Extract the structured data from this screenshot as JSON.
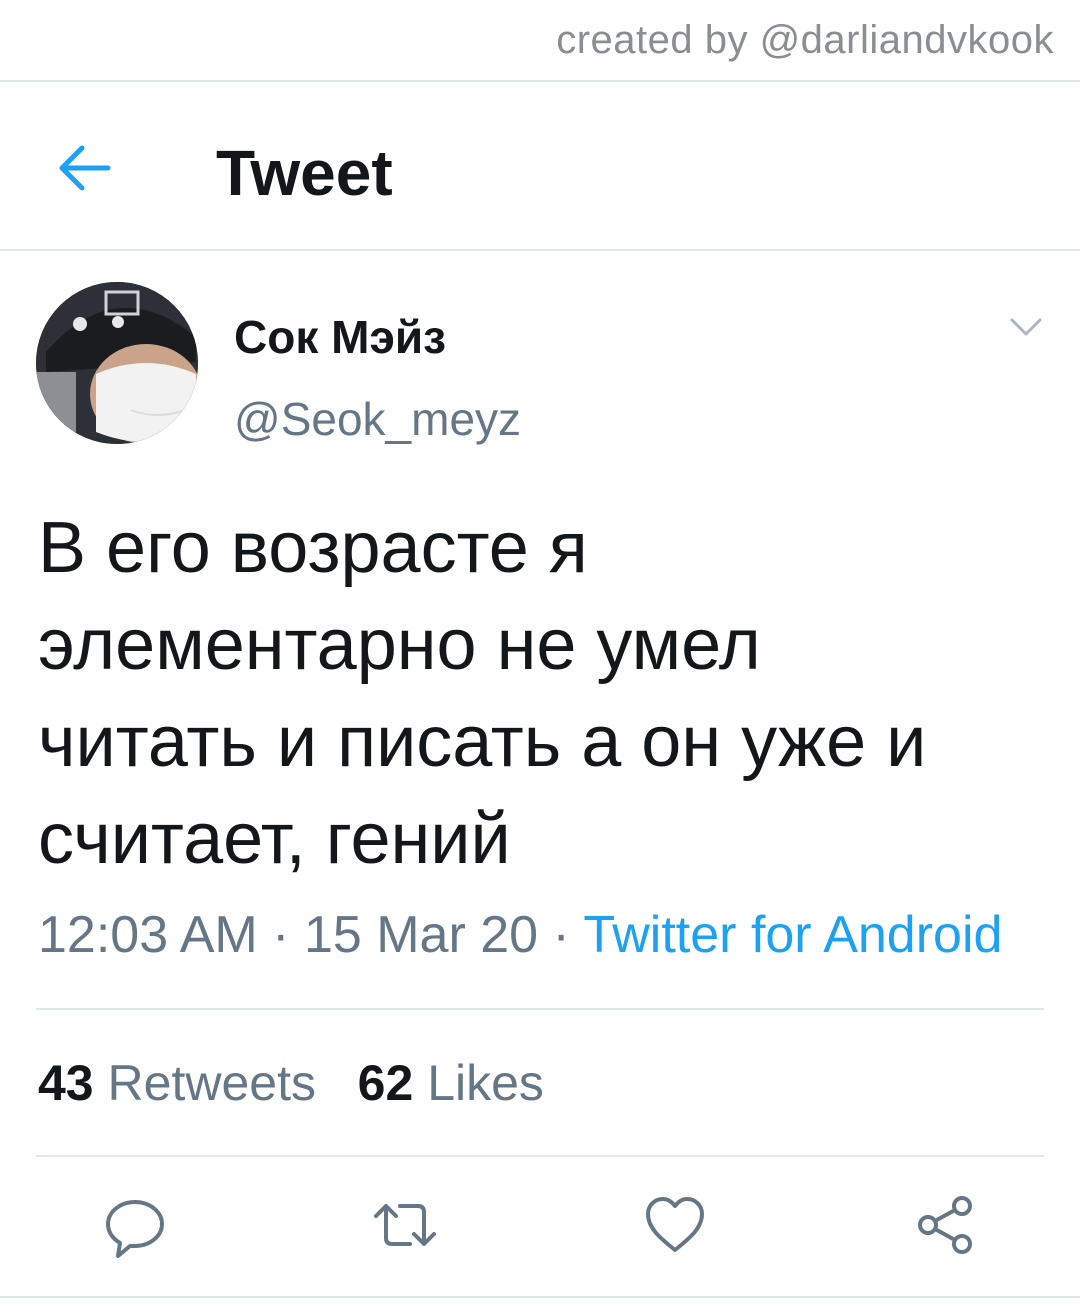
{
  "watermark": "created by @darliandvkook",
  "header": {
    "title": "Tweet",
    "back_icon": "arrow-left-icon"
  },
  "author": {
    "display_name": "Сок Мэйз",
    "handle": "@Seok_meyz"
  },
  "tweet": {
    "lines": [
      "В его возрасте я",
      "элементарно не умел",
      "читать и писать а он уже и",
      "считает, гений"
    ],
    "time": "12:03 AM",
    "date": "15 Mar 20",
    "source": "Twitter for Android"
  },
  "stats": {
    "retweets_count": "43",
    "retweets_label": "Retweets",
    "likes_count": "62",
    "likes_label": "Likes"
  },
  "actions": [
    "reply-icon",
    "retweet-icon",
    "like-icon",
    "share-icon"
  ],
  "colors": {
    "accent": "#1da1f2",
    "text": "#14171a",
    "secondary": "#657786",
    "divider": "#e1e8ed"
  }
}
